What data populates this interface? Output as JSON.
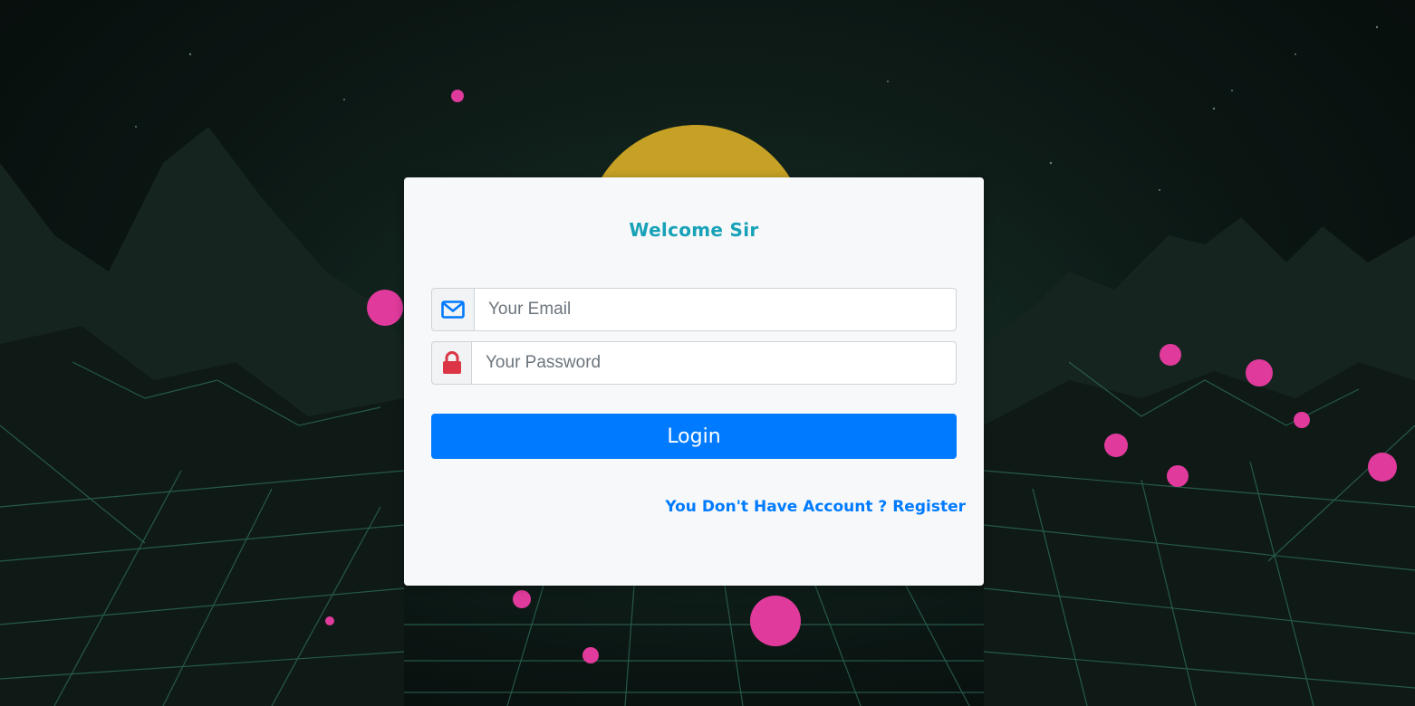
{
  "form": {
    "title": "Welcome Sir",
    "email_placeholder": "Your Email",
    "password_placeholder": "Your Password",
    "login_label": "Login",
    "register_link": "You Don't Have Account ? Register"
  },
  "icons": {
    "email": "envelope-icon",
    "password": "lock-icon"
  },
  "colors": {
    "title": "#17a2b8",
    "primary": "#007bff",
    "lock": "#dc3545",
    "card_bg": "#f7f8fa"
  }
}
